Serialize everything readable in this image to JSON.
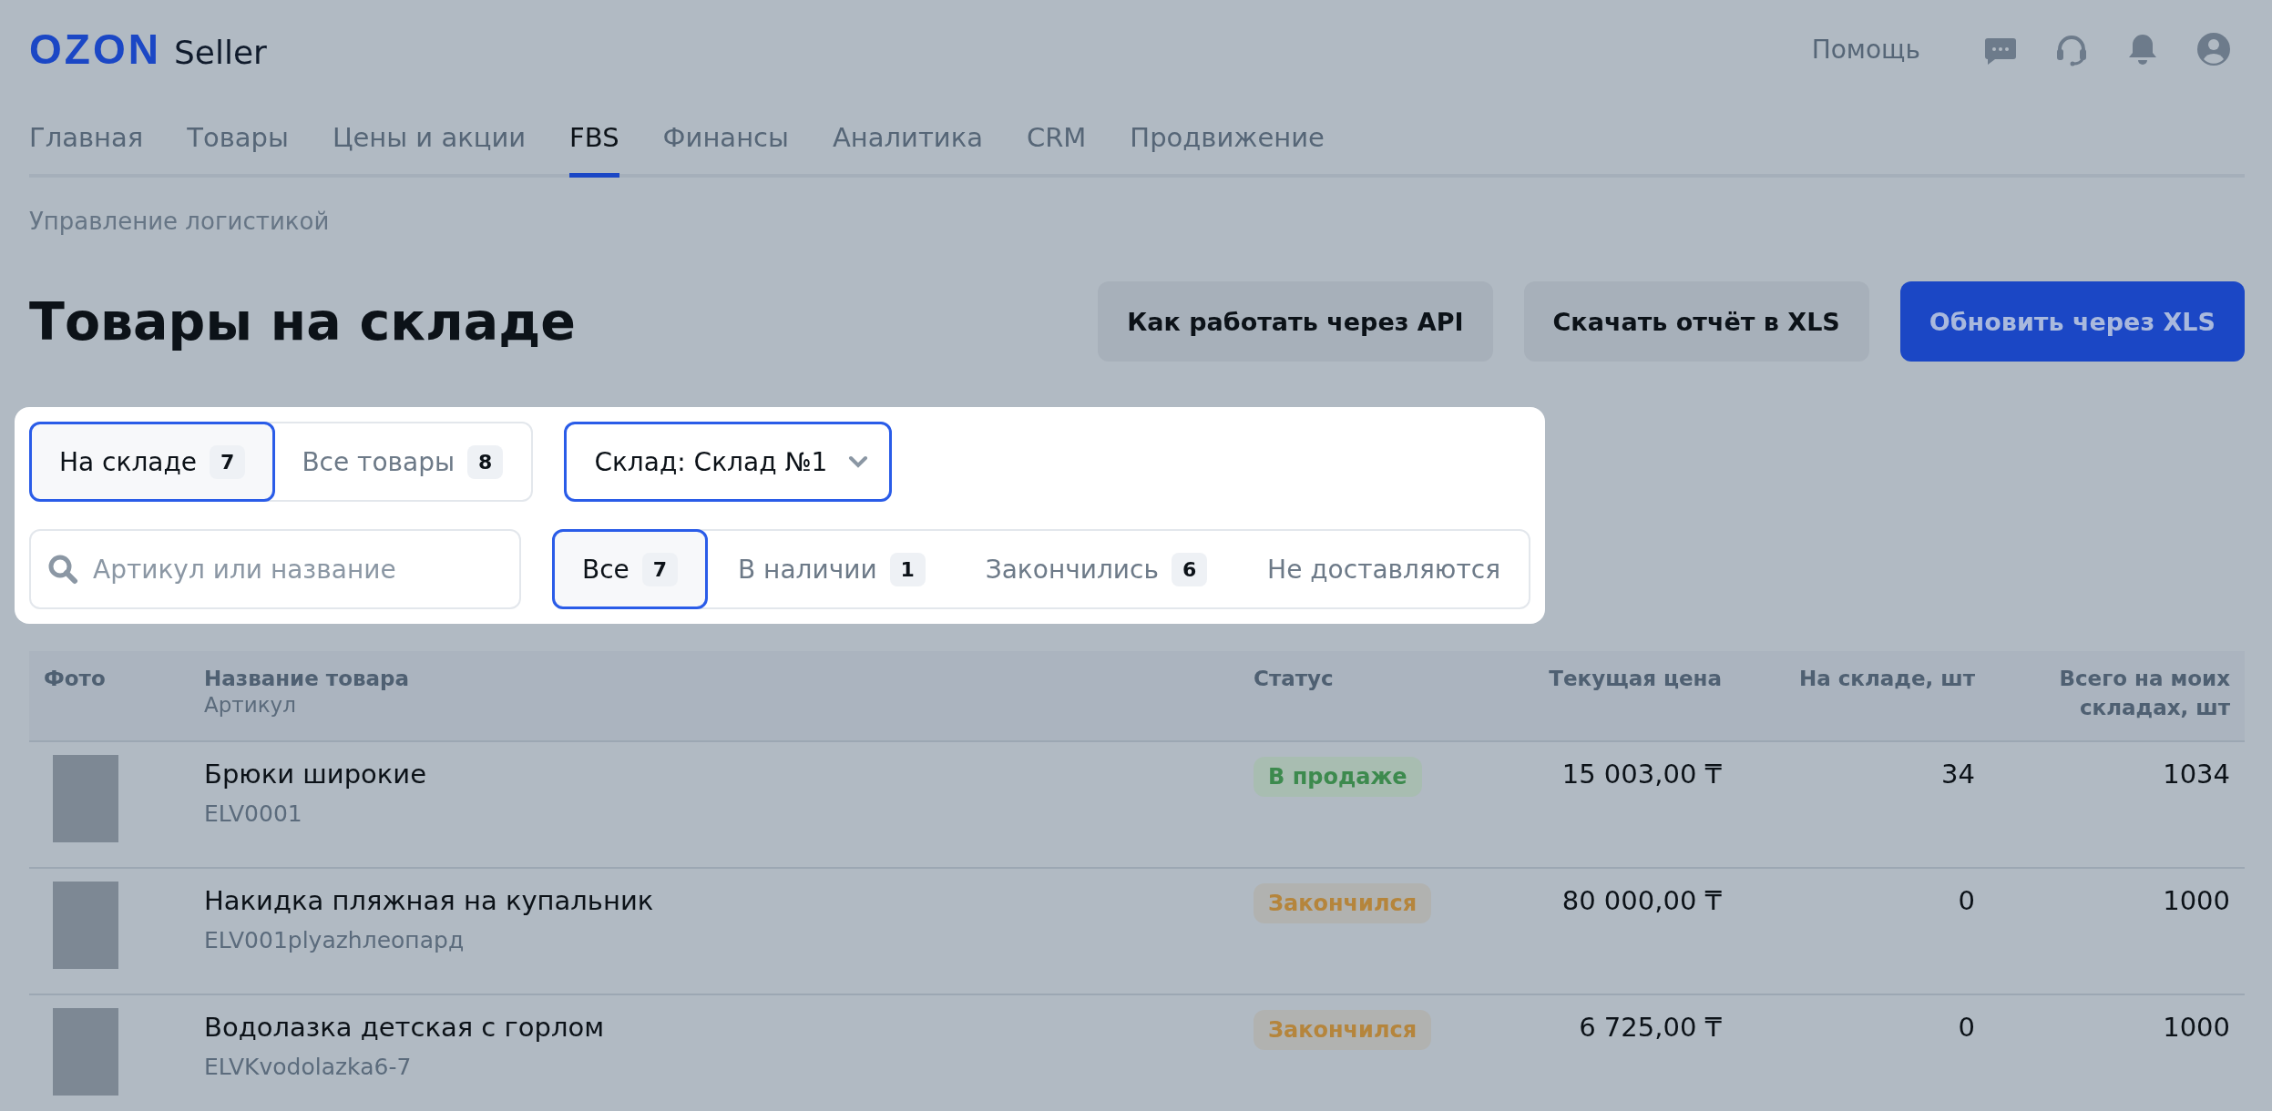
{
  "header": {
    "logo": "OZON",
    "logo_suffix": "Seller",
    "help": "Помощь"
  },
  "nav": [
    {
      "label": "Главная",
      "selected": false
    },
    {
      "label": "Товары",
      "selected": false
    },
    {
      "label": "Цены и акции",
      "selected": false
    },
    {
      "label": "FBS",
      "selected": true
    },
    {
      "label": "Финансы",
      "selected": false
    },
    {
      "label": "Аналитика",
      "selected": false
    },
    {
      "label": "CRM",
      "selected": false
    },
    {
      "label": "Продвижение",
      "selected": false
    }
  ],
  "breadcrumb": "Управление логистикой",
  "title": "Товары на складе",
  "buttons": [
    {
      "label": "Как работать через API",
      "kind": "secondary"
    },
    {
      "label": "Скачать отчёт в XLS",
      "kind": "secondary"
    },
    {
      "label": "Обновить через XLS",
      "kind": "primary"
    }
  ],
  "scope_tabs": [
    {
      "label": "На складе",
      "count": "7",
      "selected": true
    },
    {
      "label": "Все товары",
      "count": "8",
      "selected": false
    }
  ],
  "warehouse_select": {
    "value": "Склад: Склад №1"
  },
  "search": {
    "placeholder": "Артикул или название"
  },
  "status_tabs": [
    {
      "label": "Все",
      "count": "7",
      "selected": true
    },
    {
      "label": "В наличии",
      "count": "1",
      "selected": false
    },
    {
      "label": "Закончились",
      "count": "6",
      "selected": false
    },
    {
      "label": "Не доставляются",
      "selected": false
    }
  ],
  "table": {
    "columns": [
      {
        "label": "Фото"
      },
      {
        "label": "Название товара",
        "sublabel": "Артикул"
      },
      {
        "label": "Статус"
      },
      {
        "label": "Текущая цена"
      },
      {
        "label": "На складе, шт"
      },
      {
        "label": "Всего на моих складах, шт"
      }
    ],
    "rows": [
      {
        "name": "Брюки широкие",
        "sku": "ELV0001",
        "status": {
          "label": "В продаже",
          "kind": "on_sale"
        },
        "price": "15 003,00 ₸",
        "stock": "34",
        "total": "1034"
      },
      {
        "name": "Накидка пляжная на купальник",
        "sku": "ELV001plyazhлеопард",
        "status": {
          "label": "Закончился",
          "kind": "out"
        },
        "price": "80 000,00 ₸",
        "stock": "0",
        "total": "1000"
      },
      {
        "name": "Водолазка детская с горлом",
        "sku": "ELVKvodolazka6-7",
        "status": {
          "label": "Закончился",
          "kind": "out"
        },
        "price": "6 725,00 ₸",
        "stock": "0",
        "total": "1000"
      }
    ]
  }
}
